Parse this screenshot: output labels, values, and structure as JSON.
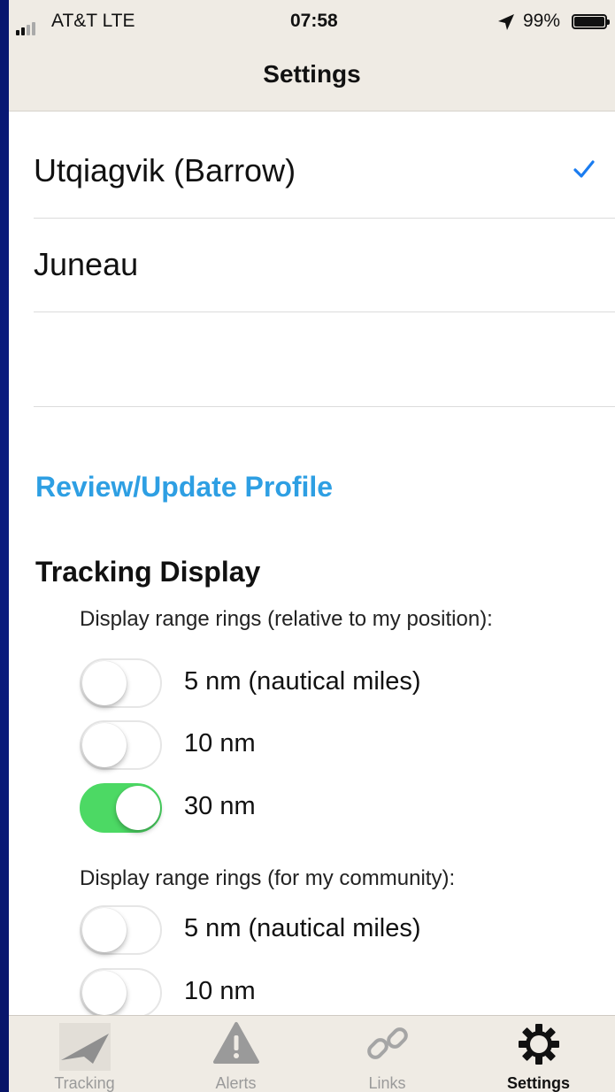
{
  "status_bar": {
    "carrier": "AT&T  LTE",
    "time": "07:58",
    "battery_percent": "99%",
    "icons": [
      "signal-icon",
      "location-arrow-icon",
      "battery-icon"
    ]
  },
  "nav": {
    "title": "Settings"
  },
  "communities": [
    {
      "label": "Utqiagvik (Barrow)",
      "selected": true
    },
    {
      "label": "Juneau",
      "selected": false
    },
    {
      "label": "",
      "selected": false
    }
  ],
  "profile_link": "Review/Update Profile",
  "tracking": {
    "heading": "Tracking Display",
    "my_position": {
      "label": "Display range rings (relative to my position):",
      "options": [
        {
          "label": "5 nm (nautical miles)",
          "on": false
        },
        {
          "label": "10 nm",
          "on": false
        },
        {
          "label": "30 nm",
          "on": true
        }
      ]
    },
    "community": {
      "label": "Display range rings (for my community):",
      "options": [
        {
          "label": "5 nm (nautical miles)",
          "on": false
        },
        {
          "label": "10 nm",
          "on": false
        }
      ]
    }
  },
  "tabs": [
    {
      "label": "Tracking",
      "icon": "tracking-plane-icon",
      "active": false
    },
    {
      "label": "Alerts",
      "icon": "alert-triangle-icon",
      "active": false
    },
    {
      "label": "Links",
      "icon": "link-icon",
      "active": false
    },
    {
      "label": "Settings",
      "icon": "gear-icon",
      "active": true
    }
  ],
  "colors": {
    "accent_link": "#2e9fe3",
    "checkmark": "#1a7cf0",
    "toggle_on": "#4cd964",
    "bar_background": "#efebe4",
    "frame_background": "#0b1f8a"
  }
}
